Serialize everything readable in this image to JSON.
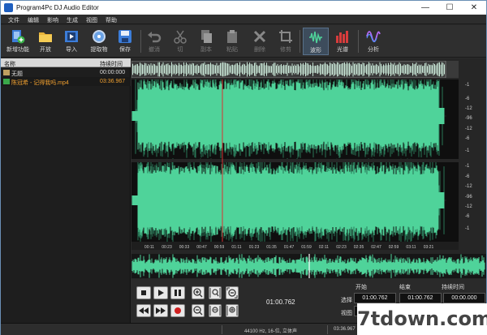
{
  "window": {
    "title": "Program4Pc DJ Audio Editor",
    "minimize": "—",
    "maximize": "☐",
    "close": "✕"
  },
  "menu": [
    "文件",
    "编辑",
    "影响",
    "生成",
    "视图",
    "帮助"
  ],
  "toolbar": [
    {
      "label": "新增功能",
      "icon": "add-document-icon",
      "enabled": true
    },
    {
      "label": "开放",
      "icon": "folder-icon",
      "enabled": true
    },
    {
      "label": "导入",
      "icon": "film-import-icon",
      "enabled": true
    },
    {
      "label": "提取物",
      "icon": "disc-icon",
      "enabled": true
    },
    {
      "label": "保存",
      "icon": "save-icon",
      "enabled": true
    },
    {
      "label": "撤消",
      "icon": "undo-icon",
      "enabled": false
    },
    {
      "label": "切",
      "icon": "scissors-icon",
      "enabled": false
    },
    {
      "label": "副本",
      "icon": "copy-icon",
      "enabled": false
    },
    {
      "label": "粘贴",
      "icon": "paste-icon",
      "enabled": false
    },
    {
      "label": "删除",
      "icon": "delete-icon",
      "enabled": false
    },
    {
      "label": "修剪",
      "icon": "crop-icon",
      "enabled": false
    },
    {
      "label": "波形",
      "icon": "waveform-icon",
      "enabled": true,
      "active": true
    },
    {
      "label": "光谱",
      "icon": "spectrum-icon",
      "enabled": true
    },
    {
      "label": "分析",
      "icon": "analysis-icon",
      "enabled": true
    }
  ],
  "filelist": {
    "col_name": "名称",
    "col_duration": "持续时间",
    "rows": [
      {
        "name": "无题",
        "duration": "00:00:000",
        "color": "#dddddd"
      },
      {
        "name": "陈冠希 - 记得我吗.mp4",
        "duration": "03:36.967",
        "color": "#f0a030"
      }
    ]
  },
  "ruler_right": [
    "-1",
    "-6",
    "-12",
    "-96",
    "-12",
    "-6",
    "-1",
    "-1",
    "-6",
    "-12",
    "-96",
    "-12",
    "-6",
    "-1"
  ],
  "time_ticks": [
    "00:11",
    "00:23",
    "00:33",
    "00:47",
    "00:59",
    "01:11",
    "01:23",
    "01:35",
    "01:47",
    "01:59",
    "02:11",
    "02:23",
    "02:35",
    "02:47",
    "02:59",
    "03:11",
    "03:21"
  ],
  "cursor_time": "01:00.762",
  "selection": {
    "col_start": "开始",
    "col_end": "结束",
    "col_duration": "持续时间",
    "row_select": "选择",
    "row_view": "视图",
    "select_start": "01:00.762",
    "select_end": "01:00.762",
    "select_duration": "00:00.000"
  },
  "status": {
    "format": "44100 Hz, 16-位, 立体声",
    "length": "03:36.967"
  },
  "watermark": "7tdown.com",
  "colors": {
    "wave": "#4fd39a",
    "cursor": "#d83030",
    "accent": "#3d4c5c"
  }
}
